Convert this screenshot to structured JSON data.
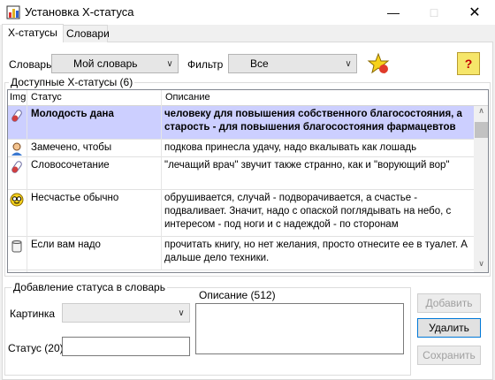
{
  "window": {
    "title": "Установка X-статуса"
  },
  "tabs": [
    {
      "label": "X-статусы",
      "active": true
    },
    {
      "label": "Словари",
      "active": false
    }
  ],
  "toolbar": {
    "dict_label": "Словарь",
    "dict_value": "Мой словарь",
    "filter_label": "Фильтр",
    "filter_value": "Все",
    "favorite_icon": "star-icon",
    "help_label": "?"
  },
  "available": {
    "group_label": "Доступные X-статусы (6)",
    "columns": [
      "Img",
      "Статус",
      "Описание"
    ],
    "rows": [
      {
        "icon": "pill-icon",
        "status": "Молодость дана",
        "description": "человеку для повышения собственного благосостояния, а старость - для повышения благосостояния фармацевтов",
        "selected": true
      },
      {
        "icon": "person-icon",
        "status": "Замечено, чтобы",
        "description": "подкова принесла удачу, надо вкалывать как лошадь",
        "selected": false
      },
      {
        "icon": "pill-icon",
        "status": "Словосочетание",
        "description": "\"лечащий врач\" звучит также странно, как и \"ворующий вор\"",
        "selected": false
      },
      {
        "icon": "nerd-face-icon",
        "status": "Несчастье обычно",
        "description": "обрушивается, случай - подворачивается, а счастье - подваливает. Значит, надо с опаской поглядывать на небо, с интересом - под ноги и с надеждой - по сторонам",
        "selected": false
      },
      {
        "icon": "toilet-paper-icon",
        "status": "Если вам надо",
        "description": "прочитать книгу, но нет желания, просто отнесите ее в туалет. А дальше дело техники.",
        "selected": false
      }
    ]
  },
  "add": {
    "group_label": "Добавление статуса в словарь",
    "picture_label": "Картинка",
    "picture_value": "",
    "status_label": "Статус (20)",
    "status_value": "",
    "desc_label": "Описание (512)",
    "desc_value": "",
    "add_button": "Добавить",
    "delete_button": "Удалить",
    "save_button": "Сохранить"
  },
  "colors": {
    "selection": "#cccfff",
    "focus_border": "#0078d7"
  }
}
